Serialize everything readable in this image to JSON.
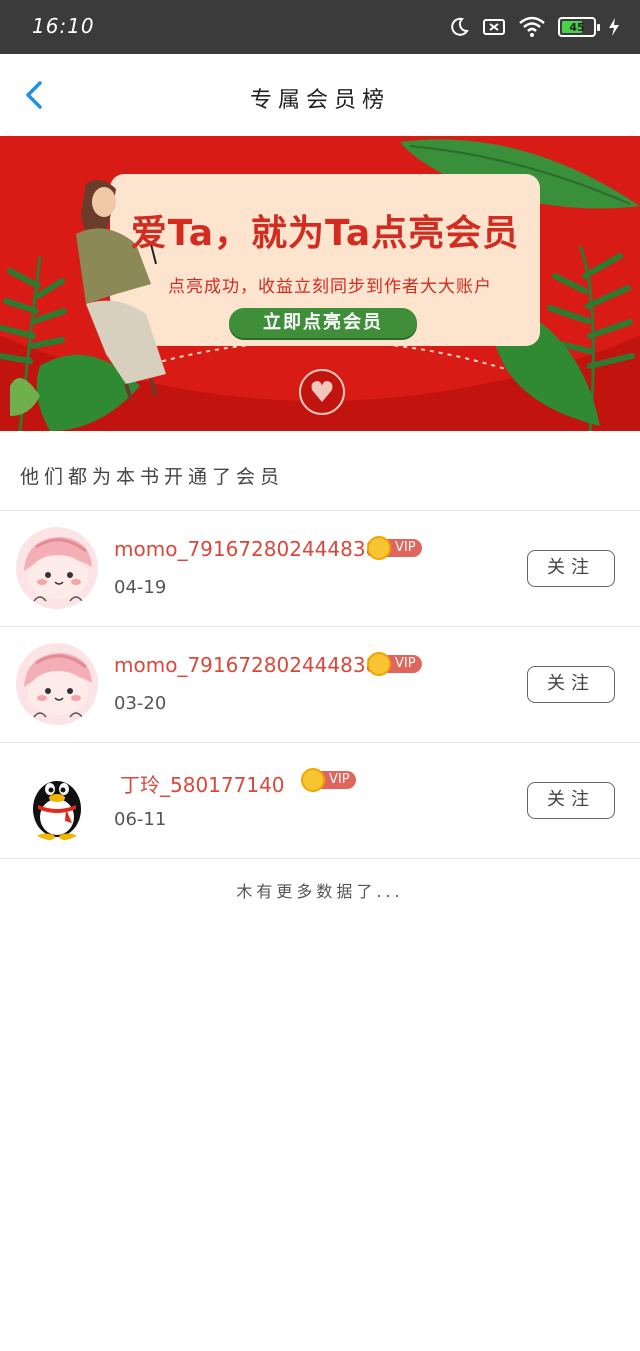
{
  "status_bar": {
    "time": "16:10",
    "battery": "45"
  },
  "header": {
    "title": "专属会员榜"
  },
  "banner": {
    "headline": "爱Ta，就为Ta点亮会员",
    "subtitle": "点亮成功，收益立刻同步到作者大大账户",
    "cta": "立即点亮会员"
  },
  "section": {
    "title": "他们都为本书开通了会员"
  },
  "members": [
    {
      "name": "momo_791672802444838",
      "badge": "VIP",
      "date": "04-19",
      "follow": "关注",
      "avatar": "pink-cartoon-avatar"
    },
    {
      "name": "momo_791672802444838",
      "badge": "VIP",
      "date": "03-20",
      "follow": "关注",
      "avatar": "pink-cartoon-avatar"
    },
    {
      "name": "丁玲_580177140",
      "badge": "VIP",
      "date": "06-11",
      "follow": "关注",
      "avatar": "qq-penguin-avatar"
    }
  ],
  "footer": {
    "note": "木有更多数据了..."
  },
  "colors": {
    "banner_red": "#d81b14",
    "name_red": "#d9483b",
    "cta_green": "#3f8e3a",
    "back_blue": "#1e90e6"
  }
}
